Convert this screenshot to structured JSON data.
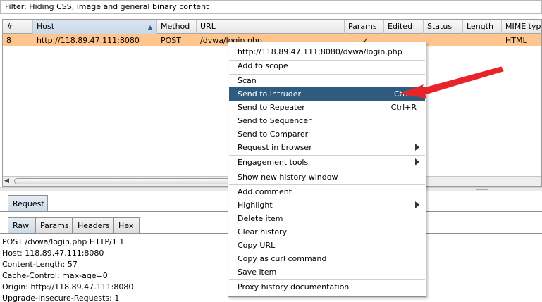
{
  "filter": {
    "text": "Filter: Hiding CSS, image and general binary content"
  },
  "table": {
    "columns": [
      "#",
      "Host",
      "Method",
      "URL",
      "Params",
      "Edited",
      "Status",
      "Length",
      "MIME type"
    ],
    "sorted_column": "Host",
    "rows": [
      {
        "num": "8",
        "host": "http://118.89.47.111:8080",
        "method": "POST",
        "url": "/dvwa/login.php",
        "params": "✓",
        "edited": "",
        "status": "",
        "length": "",
        "mime": "HTML"
      }
    ]
  },
  "request_tab": "Request",
  "sub_tabs": [
    "Raw",
    "Params",
    "Headers",
    "Hex"
  ],
  "request_lines": [
    "POST /dvwa/login.php HTTP/1.1",
    "Host: 118.89.47.111:8080",
    "Content-Length: 57",
    "Cache-Control: max-age=0",
    "Origin: http://118.89.47.111:8080",
    "Upgrade-Insecure-Requests: 1"
  ],
  "context_menu": {
    "header": "http://118.89.47.111:8080/dvwa/login.php",
    "add_to_scope": "Add to scope",
    "scan": "Scan",
    "send_to_intruder": "Send to Intruder",
    "send_to_intruder_shortcut": "Ctrl+I",
    "send_to_repeater": "Send to Repeater",
    "send_to_repeater_shortcut": "Ctrl+R",
    "send_to_sequencer": "Send to Sequencer",
    "send_to_comparer": "Send to Comparer",
    "request_in_browser": "Request in browser",
    "engagement_tools": "Engagement tools",
    "show_new_history_window": "Show new history window",
    "add_comment": "Add comment",
    "highlight": "Highlight",
    "delete_item": "Delete item",
    "clear_history": "Clear history",
    "copy_url": "Copy URL",
    "copy_as_curl_command": "Copy as curl command",
    "save_item": "Save item",
    "proxy_history_documentation": "Proxy history documentation"
  },
  "colors": {
    "selected_row": "#ffc58f",
    "menu_highlight": "#2f5b80",
    "annotation_arrow": "#e8242b"
  },
  "icons": {
    "sort": "sort-ascending-icon",
    "submenu": "submenu-arrow-icon",
    "scroll_left": "scroll-left-arrow-icon"
  }
}
